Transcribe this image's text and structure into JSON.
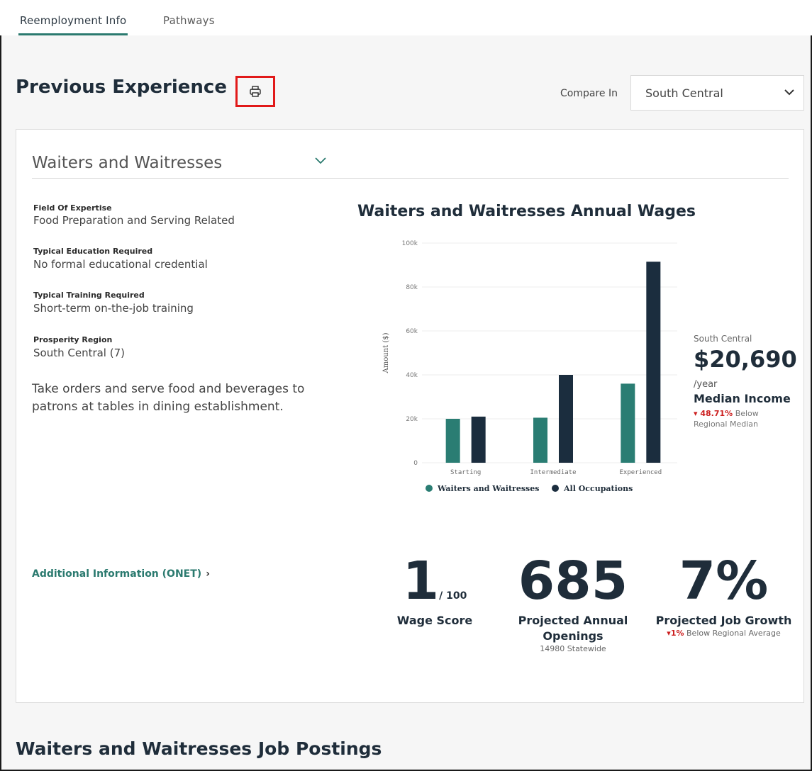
{
  "tabs": [
    {
      "label": "Reemployment Info",
      "active": true
    },
    {
      "label": "Pathways",
      "active": false
    }
  ],
  "header": {
    "title": "Previous Experience",
    "print_icon": "printer-icon",
    "compare_label": "Compare In",
    "compare_value": "South Central"
  },
  "occupation": {
    "title": "Waiters and Waitresses",
    "fields": [
      {
        "label": "Field Of Expertise",
        "value": "Food Preparation and Serving Related"
      },
      {
        "label": "Typical Education Required",
        "value": "No formal educational credential"
      },
      {
        "label": "Typical Training Required",
        "value": "Short-term on-the-job training"
      },
      {
        "label": "Prosperity Region",
        "value": "South Central (7)"
      }
    ],
    "description": "Take orders and serve food and beverages to patrons at tables in dining establishment.",
    "onet_link": "Additional Information (ONET)"
  },
  "chart_data": {
    "type": "bar",
    "title": "Waiters and Waitresses Annual Wages",
    "ylabel": "Amount ($)",
    "categories": [
      "Starting",
      "Intermediate",
      "Experienced"
    ],
    "series": [
      {
        "name": "Waiters and Waitresses",
        "color": "#2a7d73",
        "values": [
          20000,
          20500,
          36000
        ]
      },
      {
        "name": "All Occupations",
        "color": "#1b2d3e",
        "values": [
          21000,
          40000,
          91500
        ]
      }
    ],
    "ylim": [
      0,
      100000
    ],
    "yticks": [
      0,
      20000,
      40000,
      60000,
      80000,
      100000
    ],
    "ytick_labels": [
      "0",
      "20k",
      "40k",
      "60k",
      "80k",
      "100k"
    ],
    "legend_position": "bottom",
    "grid": true
  },
  "median": {
    "region": "South Central",
    "amount": "$20,690",
    "unit": "/year",
    "label": "Median Income",
    "change": "48.71%",
    "change_text": "Below Regional Median"
  },
  "metrics": {
    "wage_score": {
      "value": "1",
      "suffix": "/ 100",
      "label": "Wage Score"
    },
    "openings": {
      "value": "685",
      "label": "Projected Annual Openings",
      "sub": "14980 Statewide"
    },
    "growth": {
      "value": "7%",
      "label": "Projected Job Growth",
      "change": "1%",
      "change_text": "Below Regional Average"
    }
  },
  "footer": {
    "title": "Waiters and Waitresses Job Postings"
  }
}
